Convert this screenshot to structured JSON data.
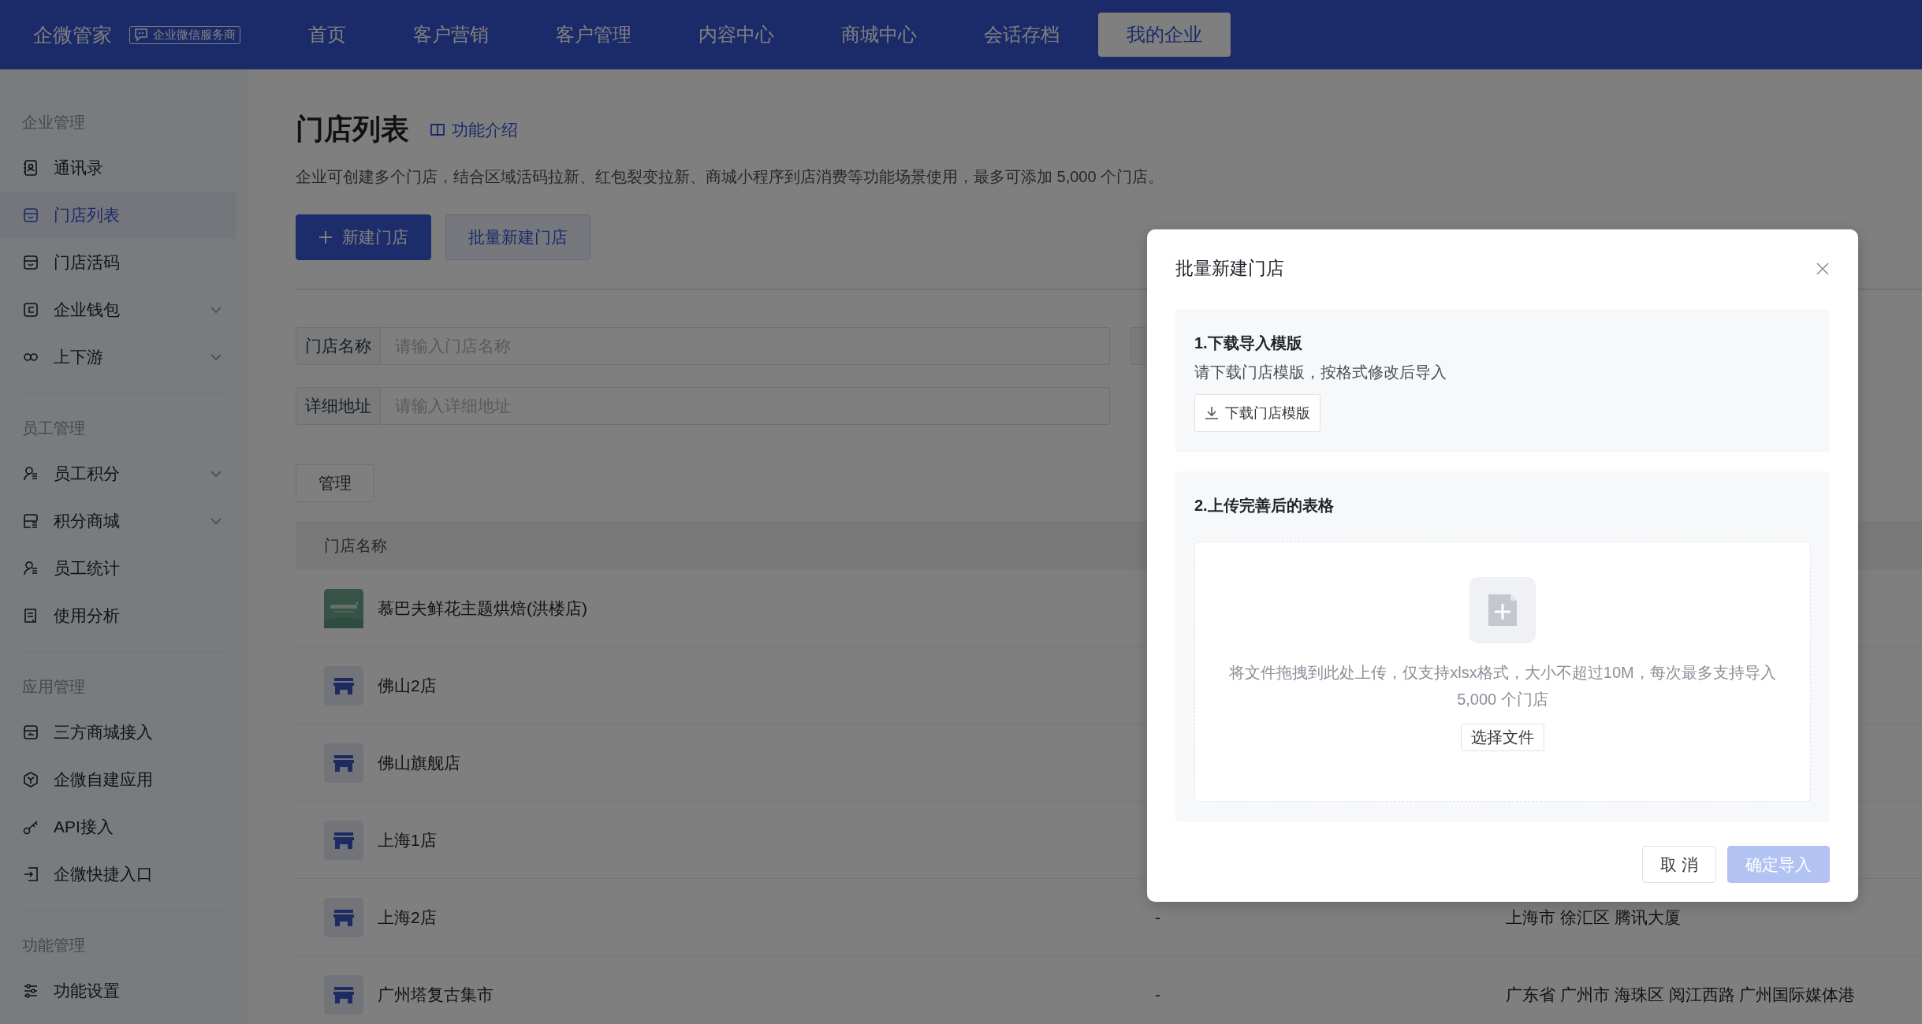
{
  "top_nav": {
    "brand": "企微管家",
    "badge": "企业微信服务商",
    "items": [
      {
        "label": "首页",
        "selected": false
      },
      {
        "label": "客户营销",
        "selected": false
      },
      {
        "label": "客户管理",
        "selected": false
      },
      {
        "label": "内容中心",
        "selected": false
      },
      {
        "label": "商城中心",
        "selected": false
      },
      {
        "label": "会话存档",
        "selected": false
      },
      {
        "label": "我的企业",
        "selected": true
      }
    ]
  },
  "sidebar": {
    "groups": [
      {
        "title": "企业管理",
        "items": [
          {
            "label": "通讯录",
            "selected": false,
            "has_submenu": false
          },
          {
            "label": "门店列表",
            "selected": true,
            "has_submenu": false
          },
          {
            "label": "门店活码",
            "selected": false,
            "has_submenu": false
          },
          {
            "label": "企业钱包",
            "selected": false,
            "has_submenu": true
          },
          {
            "label": "上下游",
            "selected": false,
            "has_submenu": true
          }
        ]
      },
      {
        "title": "员工管理",
        "items": [
          {
            "label": "员工积分",
            "selected": false,
            "has_submenu": true
          },
          {
            "label": "积分商城",
            "selected": false,
            "has_submenu": true
          },
          {
            "label": "员工统计",
            "selected": false,
            "has_submenu": false
          },
          {
            "label": "使用分析",
            "selected": false,
            "has_submenu": false
          }
        ]
      },
      {
        "title": "应用管理",
        "items": [
          {
            "label": "三方商城接入",
            "selected": false,
            "has_submenu": false
          },
          {
            "label": "企微自建应用",
            "selected": false,
            "has_submenu": false
          },
          {
            "label": "API接入",
            "selected": false,
            "has_submenu": false
          },
          {
            "label": "企微快捷入口",
            "selected": false,
            "has_submenu": false
          }
        ]
      },
      {
        "title": "功能管理",
        "items": [
          {
            "label": "功能设置",
            "selected": false,
            "has_submenu": false
          }
        ]
      }
    ]
  },
  "page": {
    "title": "门店列表",
    "intro_link": "功能介绍",
    "description": "企业可创建多个门店，结合区域活码拉新、红包裂变拉新、商城小程序到店消费等功能场景使用，最多可添加 5,000 个门店。",
    "buttons": [
      {
        "label": "新建门店",
        "kind": "primary"
      },
      {
        "label": "批量新建门店",
        "kind": "secondary"
      }
    ],
    "filters": [
      {
        "label": "门店名称",
        "placeholder": "请输入门店名称"
      },
      {
        "label": "详细地址",
        "placeholder": "请输入详细地址"
      }
    ],
    "manage_button": "管理",
    "table": {
      "columns": [
        "门店名称"
      ],
      "rows": [
        {
          "name": "慕巴夫鲜花主题烘焙(洪楼店)",
          "kind": "picture"
        },
        {
          "name": "佛山2店",
          "kind": "store"
        },
        {
          "name": "佛山旗舰店",
          "kind": "store"
        },
        {
          "name": "上海1店",
          "kind": "store"
        },
        {
          "name": "上海2店",
          "kind": "store",
          "column_2": "-",
          "column_3": "上海市 徐汇区 腾讯大厦"
        },
        {
          "name": "广州塔复古集市",
          "kind": "store",
          "column_2": "-",
          "column_3": "广东省 广州市 海珠区 阅江西路 广州国际媒体港"
        }
      ]
    }
  },
  "dialog": {
    "title": "批量新建门店",
    "steps": [
      {
        "title": "1.下载导入模版",
        "description": "请下载门店模版，按格式修改后导入",
        "button": "下载门店模版"
      },
      {
        "title": "2.上传完善后的表格",
        "hint": "将文件拖拽到此处上传，仅支持xlsx格式，大小不超过10M，每次最多支持导入 5,000 个门店",
        "button": "选择文件"
      }
    ],
    "cancel": "取 消",
    "confirm": {
      "label": "确定导入",
      "disabled": true
    }
  }
}
